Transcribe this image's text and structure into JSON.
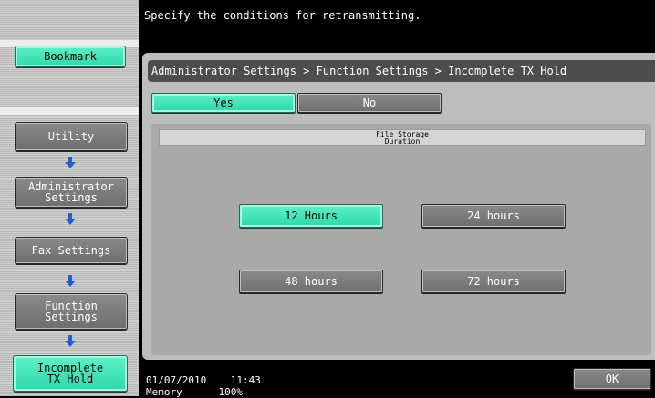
{
  "header": {
    "message": "Specify the conditions for retransmitting."
  },
  "sidebar": {
    "bookmark_label": "Bookmark",
    "path": [
      {
        "label": "Utility"
      },
      {
        "label": "Administrator\nSettings"
      },
      {
        "label": "Fax Settings"
      },
      {
        "label": "Function\nSettings"
      },
      {
        "label": "Incomplete\nTX Hold"
      }
    ]
  },
  "main": {
    "breadcrumb": "Administrator Settings > Function Settings > Incomplete TX Hold",
    "toggle": {
      "yes_label": "Yes",
      "no_label": "No",
      "selected": "Yes"
    },
    "storage": {
      "legend": "File Storage\nDuration",
      "options": [
        "12 Hours",
        "24 hours",
        "48 hours",
        "72 hours"
      ],
      "selected": "12 Hours"
    }
  },
  "footer": {
    "date": "01/07/2010",
    "time": "11:43",
    "memory_label": "Memory",
    "memory_value": "100%",
    "ok_label": "OK"
  },
  "colors": {
    "accent": "#2bd9a9",
    "button_grey": "#7a7a7a",
    "background": "#000000"
  }
}
